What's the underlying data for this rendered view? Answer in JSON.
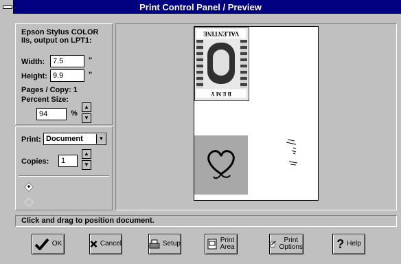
{
  "window": {
    "title": "Print Control Panel / Preview"
  },
  "printer": {
    "line1": "Epson Stylus COLOR",
    "line2": "IIs, output on LPT1:"
  },
  "size": {
    "width_label": "Width:",
    "width_value": "7.5",
    "width_unit": "\"",
    "height_label": "Height:",
    "height_value": "9.9",
    "height_unit": "\"",
    "pages_per_copy": "Pages / Copy: 1",
    "percent_label": "Percent Size:",
    "percent_value": "94",
    "percent_unit": "%"
  },
  "print": {
    "print_label": "Print:",
    "print_selected": "Document",
    "copies_label": "Copies:",
    "copies_value": "1"
  },
  "preview": {
    "valentine_text": "VALENTINE",
    "be_my": "B E  M Y"
  },
  "status": {
    "message": "Click and drag to position document."
  },
  "buttons": {
    "ok": "OK",
    "cancel": "Cancel",
    "setup": "Setup",
    "print_area_1": "Print",
    "print_area_2": "Area",
    "print_options_1": "Print",
    "print_options_2": "Options",
    "help": "Help"
  },
  "colors": {
    "titlebar": "#000080",
    "face": "#c0c0c0",
    "heart_bg": "#a8a8a8"
  }
}
